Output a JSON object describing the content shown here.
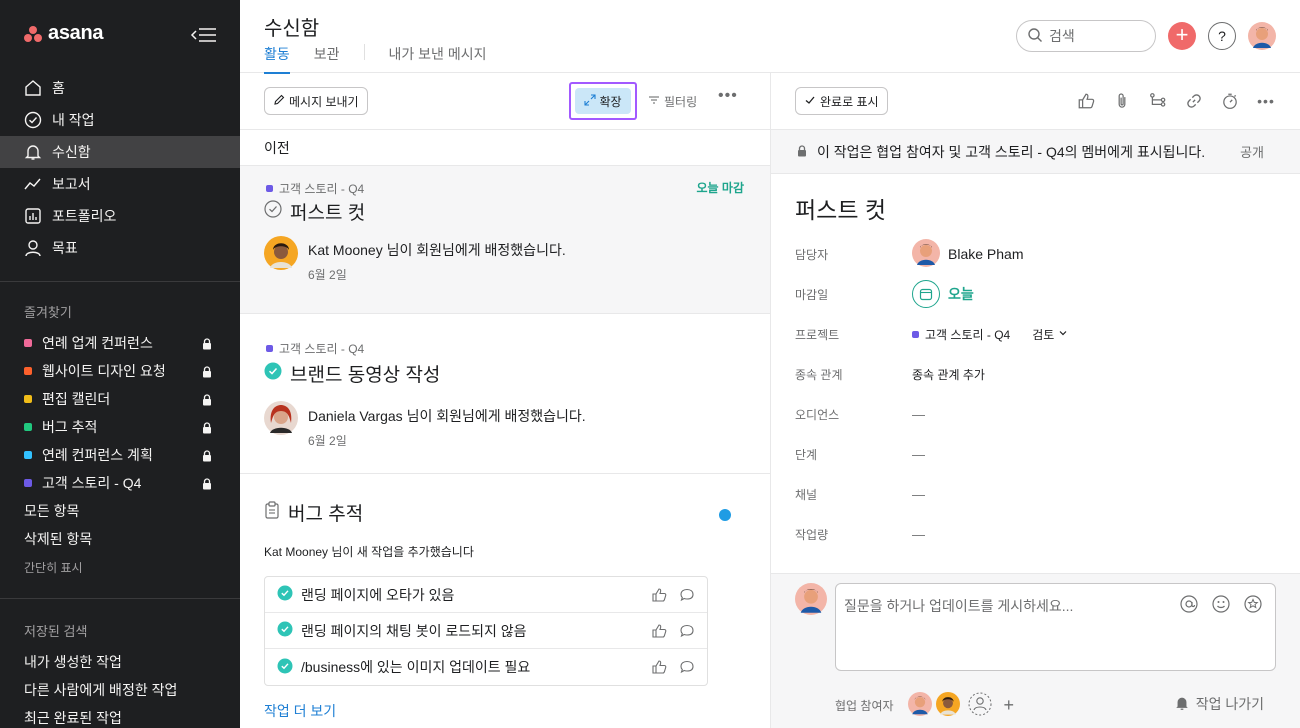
{
  "app": {
    "logo_text": "asana"
  },
  "sidebar": {
    "nav": [
      {
        "label": "홈",
        "icon": "home-icon"
      },
      {
        "label": "내 작업",
        "icon": "check-circle-icon"
      },
      {
        "label": "수신함",
        "icon": "bell-icon",
        "active": true
      },
      {
        "label": "보고서",
        "icon": "chart-line-icon"
      },
      {
        "label": "포트폴리오",
        "icon": "bar-chart-icon"
      },
      {
        "label": "목표",
        "icon": "person-icon"
      }
    ],
    "favorites_title": "즐겨찾기",
    "favorites": [
      {
        "label": "연례 업계 컨퍼런스",
        "color": "#f06a99"
      },
      {
        "label": "웹사이트 디자인 요청",
        "color": "#fd612c"
      },
      {
        "label": "편집 캘린더",
        "color": "#f1bd19"
      },
      {
        "label": "버그 추적",
        "color": "#21c87f"
      },
      {
        "label": "연례 컨퍼런스 계획",
        "color": "#32c1ff"
      },
      {
        "label": "고객 스토리 - Q4",
        "color": "#6d5ae6"
      }
    ],
    "all_items": "모든 항목",
    "deleted_items": "삭제된 항목",
    "compact_view": "간단히 표시",
    "saved_search_title": "저장된 검색",
    "saved_searches": [
      "내가 생성한 작업",
      "다른 사람에게 배정한 작업",
      "최근 완료된 작업"
    ]
  },
  "header": {
    "title": "수신함",
    "tabs": [
      "활동",
      "보관",
      "내가 보낸 메시지"
    ],
    "search_placeholder": "검색",
    "help": "?"
  },
  "list": {
    "send_message": "메시지 보내기",
    "expand": "확장",
    "filter": "필터링",
    "previous": "이전",
    "cards": [
      {
        "project": "고객 스토리 - Q4",
        "badge": "오늘 마감",
        "title": "퍼스트 컷",
        "actor": "Kat Mooney",
        "action": " 님이 회원님에게 배정했습니다.",
        "date": "6월 2일"
      },
      {
        "project": "고객 스토리 - Q4",
        "title": "브랜드 동영상 작성",
        "actor": "Daniela Vargas",
        "action": " 님이 회원님에게 배정했습니다.",
        "date": "6월 2일"
      }
    ],
    "bug": {
      "title": "버그 추적",
      "actor": "Kat Mooney",
      "action": " 님이 새 작업을 추가했습니다",
      "tasks": [
        "랜딩 페이지에 오타가 있음",
        "랜딩 페이지의 채팅 봇이 로드되지 않음",
        "/business에 있는 이미지 업데이트 필요"
      ],
      "see_more": "작업 더 보기"
    }
  },
  "detail": {
    "complete": "완료로 표시",
    "notice": "이 작업은 협업 참여자 및 고객 스토리 - Q4의 멤버에게 표시됩니다.",
    "public": "공개",
    "title": "퍼스트 컷",
    "fields": {
      "assignee_label": "담당자",
      "assignee": "Blake Pham",
      "due_label": "마감일",
      "due": "오늘",
      "project_label": "프로젝트",
      "project": "고객 스토리 - Q4",
      "status": "검토",
      "deps_label": "종속 관계",
      "deps": "종속 관계 추가",
      "audience_label": "오디언스",
      "stage_label": "단계",
      "channel_label": "채널",
      "workload_label": "작업량",
      "empty": "—"
    },
    "comment_placeholder": "질문을 하거나 업데이트를 게시하세요...",
    "collaborators": "협업 참여자",
    "leave": "작업 나가기"
  },
  "colors": {
    "accent": "#1e7fd4",
    "brand": "#f06a6a",
    "success": "#1ea58d",
    "sidebar": "#1e1f21"
  }
}
